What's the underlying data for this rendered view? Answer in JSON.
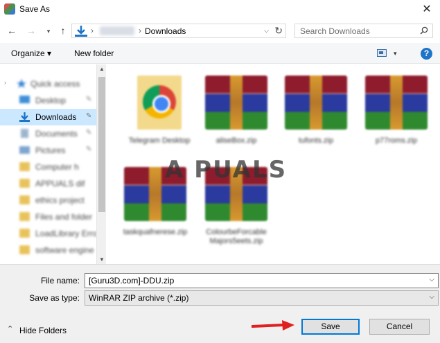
{
  "window": {
    "title": "Save As",
    "close_glyph": "✕"
  },
  "nav": {
    "back_glyph": "←",
    "forward_glyph": "→",
    "recent_glyph": "▾",
    "up_glyph": "↑",
    "address_separator": "›",
    "address_current": "Downloads",
    "address_dropdown_glyph": "⌵",
    "refresh_glyph": "↻"
  },
  "search": {
    "placeholder": "Search Downloads",
    "icon": "⚲"
  },
  "toolbar": {
    "organize_label": "Organize ▾",
    "new_folder_label": "New folder",
    "view_dropdown_glyph": "▾",
    "help_label": "?"
  },
  "sidebar": {
    "items": [
      {
        "label": "Quick access",
        "blurred": true
      },
      {
        "label": "Desktop",
        "blurred": true
      },
      {
        "label": "Downloads",
        "blurred": false,
        "selected": true
      },
      {
        "label": "Documents",
        "blurred": true
      },
      {
        "label": "Pictures",
        "blurred": true
      },
      {
        "label": "Computer h",
        "blurred": true
      },
      {
        "label": "APPUALS dif",
        "blurred": true
      },
      {
        "label": "ethics project",
        "blurred": true
      },
      {
        "label": "Files and folder",
        "blurred": true
      },
      {
        "label": "LoadLibrary Erro",
        "blurred": true
      },
      {
        "label": "software engine",
        "blurred": true
      }
    ],
    "pin_glyph": "📌"
  },
  "files": [
    {
      "name": "Telegram Desktop",
      "kind": "chrome"
    },
    {
      "name": "aliseBox.zip",
      "kind": "zip"
    },
    {
      "name": "tufonts.zip",
      "kind": "zip"
    },
    {
      "name": "p77roms.zip",
      "kind": "zip"
    },
    {
      "name": "taskquafnerese.zip",
      "kind": "zip"
    },
    {
      "name": "ColourbeForcable Majors5eets.zip",
      "kind": "zip"
    }
  ],
  "watermark": "A PUALS",
  "form": {
    "file_name_label": "File name:",
    "file_name_value": "[Guru3D.com]-DDU.zip",
    "save_type_label": "Save as type:",
    "save_type_value": "WinRAR ZIP archive (*.zip)",
    "dropdown_glyph": "⌵"
  },
  "footer": {
    "hide_folders_label": "Hide Folders",
    "hide_folders_glyph": "⌃",
    "save_label": "Save",
    "cancel_label": "Cancel"
  },
  "colors": {
    "accent": "#0078d7",
    "selected_bg": "#cce8ff",
    "annotation_arrow": "#e02020"
  }
}
